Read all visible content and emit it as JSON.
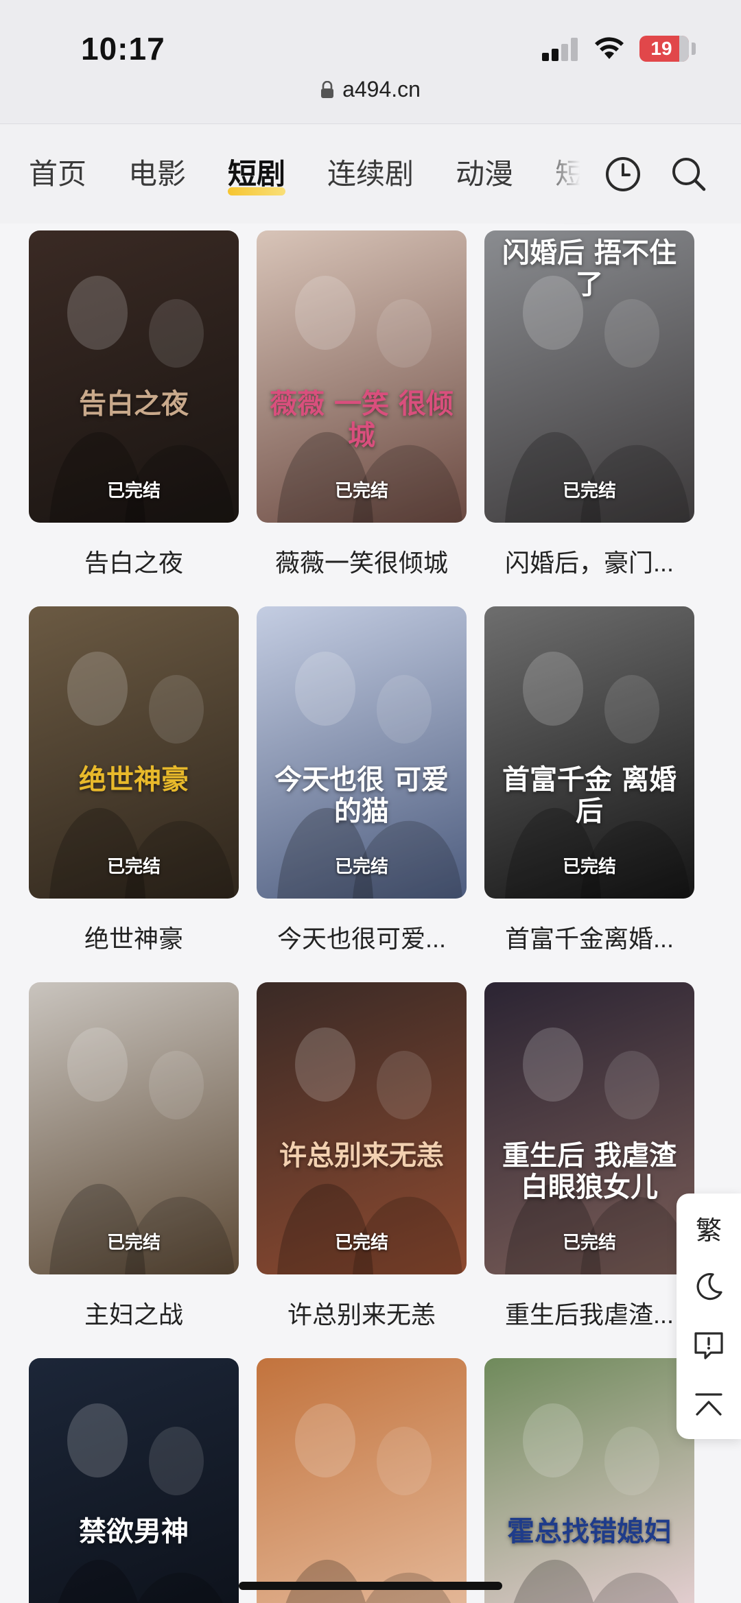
{
  "status_bar": {
    "time": "10:17",
    "battery": "19"
  },
  "address_bar": {
    "url": "a494.cn"
  },
  "nav": {
    "tabs": [
      "首页",
      "电影",
      "短剧",
      "连续剧",
      "动漫",
      "短"
    ],
    "active_tab": "短剧",
    "history_icon": "clock-icon",
    "search_icon": "search-icon"
  },
  "grid": {
    "items": [
      {
        "title": "告白之夜",
        "status": "已完结",
        "colors": [
          "#3a2a24",
          "#1a1512"
        ],
        "accent": "#c9a98b",
        "poster_text": "告白之夜"
      },
      {
        "title": "薇薇一笑很倾城",
        "status": "已完结",
        "colors": [
          "#d8c4b8",
          "#6b4a42"
        ],
        "accent": "#d94f7d",
        "poster_text": "薇薇 一笑 很倾城"
      },
      {
        "title": "闪婚后，豪门...",
        "status": "已完结",
        "colors": [
          "#8a8c90",
          "#3d3a3b"
        ],
        "accent": "#ffffff",
        "poster_text": "闪婚后 捂不住了"
      },
      {
        "title": "绝世神豪",
        "status": "已完结",
        "colors": [
          "#6b5a43",
          "#2f261c"
        ],
        "accent": "#e8b92b",
        "poster_text": "绝世神豪"
      },
      {
        "title": "今天也很可爱...",
        "status": "已完结",
        "colors": [
          "#c4cde2",
          "#4d5c7e"
        ],
        "accent": "#ffffff",
        "poster_text": "今天也很 可爱的猫"
      },
      {
        "title": "首富千金离婚...",
        "status": "已完结",
        "colors": [
          "#6e6e6e",
          "#151515"
        ],
        "accent": "#ffffff",
        "poster_text": "首富千金 离婚后"
      },
      {
        "title": "主妇之战",
        "status": "已完结",
        "colors": [
          "#c9c4be",
          "#5d4a36"
        ],
        "accent": "#ffffff",
        "poster_text": ""
      },
      {
        "title": "许总别来无恙",
        "status": "已完结",
        "colors": [
          "#3a2a26",
          "#8d4a30"
        ],
        "accent": "#f2d0b0",
        "poster_text": "许总别来无恙"
      },
      {
        "title": "重生后我虐渣...",
        "status": "已完结",
        "colors": [
          "#2b2433",
          "#7a5d57"
        ],
        "accent": "#ffffff",
        "poster_text": "重生后 我虐渣白眼狼女儿"
      },
      {
        "title": "",
        "status": "",
        "colors": [
          "#1c2638",
          "#0c1018"
        ],
        "accent": "#ffffff",
        "poster_text": "禁欲男神"
      },
      {
        "title": "",
        "status": "",
        "colors": [
          "#c2733d",
          "#e8c0a3"
        ],
        "accent": "#ffffff",
        "poster_text": ""
      },
      {
        "title": "",
        "status": "",
        "colors": [
          "#6f8a5b",
          "#f3d7e0"
        ],
        "accent": "#1f3c8a",
        "poster_text": "霍总找错媳妇"
      }
    ]
  },
  "sidebar": {
    "traditional_label": "繁",
    "icons": [
      "traditional-chinese-toggle",
      "moon-icon",
      "feedback-icon",
      "back-to-top-icon"
    ]
  }
}
